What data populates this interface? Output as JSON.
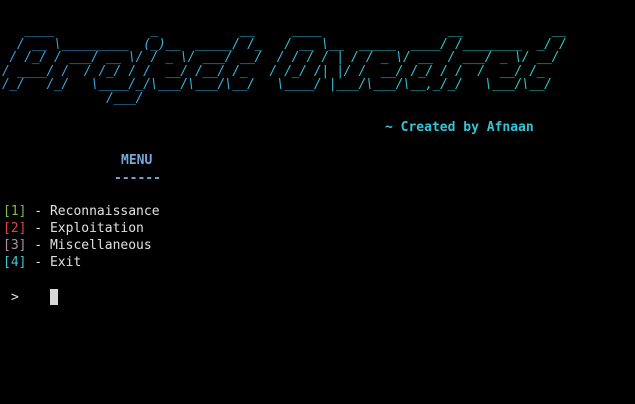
{
  "banner": {
    "lines": [
      "   ____             _           __     ____                 __            __",
      "  / __ \\_________  (_)__  _____/ /_   / __ \\__  _____  ____/ /________  _/ /",
      " / /_/ / ___/ __ \\/ / _ \\/ ___/ __/  / / / / | / / _ \\/ __  / ___/ _ \\/ __/",
      "/ ____/ /  / /_/ / /  __/ /__/ /_   / /_/ /| |/ /  __/ /_/ / /  /  __/ /_",
      "/_/   /_/   \\____/_/\\___/\\___/\\__/   \\____/ |___/\\___/\\__,_/_/   \\___/\\__/",
      "              /___/"
    ]
  },
  "credit": "~ Created by Afnaan",
  "menu": {
    "title": "MENU",
    "underline": "------",
    "options": [
      {
        "number": "[1]",
        "label": " - Reconnaissance",
        "color": "#7cc04b"
      },
      {
        "number": "[2]",
        "label": " - Exploitation",
        "color": "#e0473f"
      },
      {
        "number": "[3]",
        "label": " - Miscellaneous",
        "color": "#b48ead"
      },
      {
        "number": "[4]",
        "label": " - Exit",
        "color": "#3fc7d8"
      }
    ]
  },
  "prompt": {
    "symbol": ">"
  }
}
